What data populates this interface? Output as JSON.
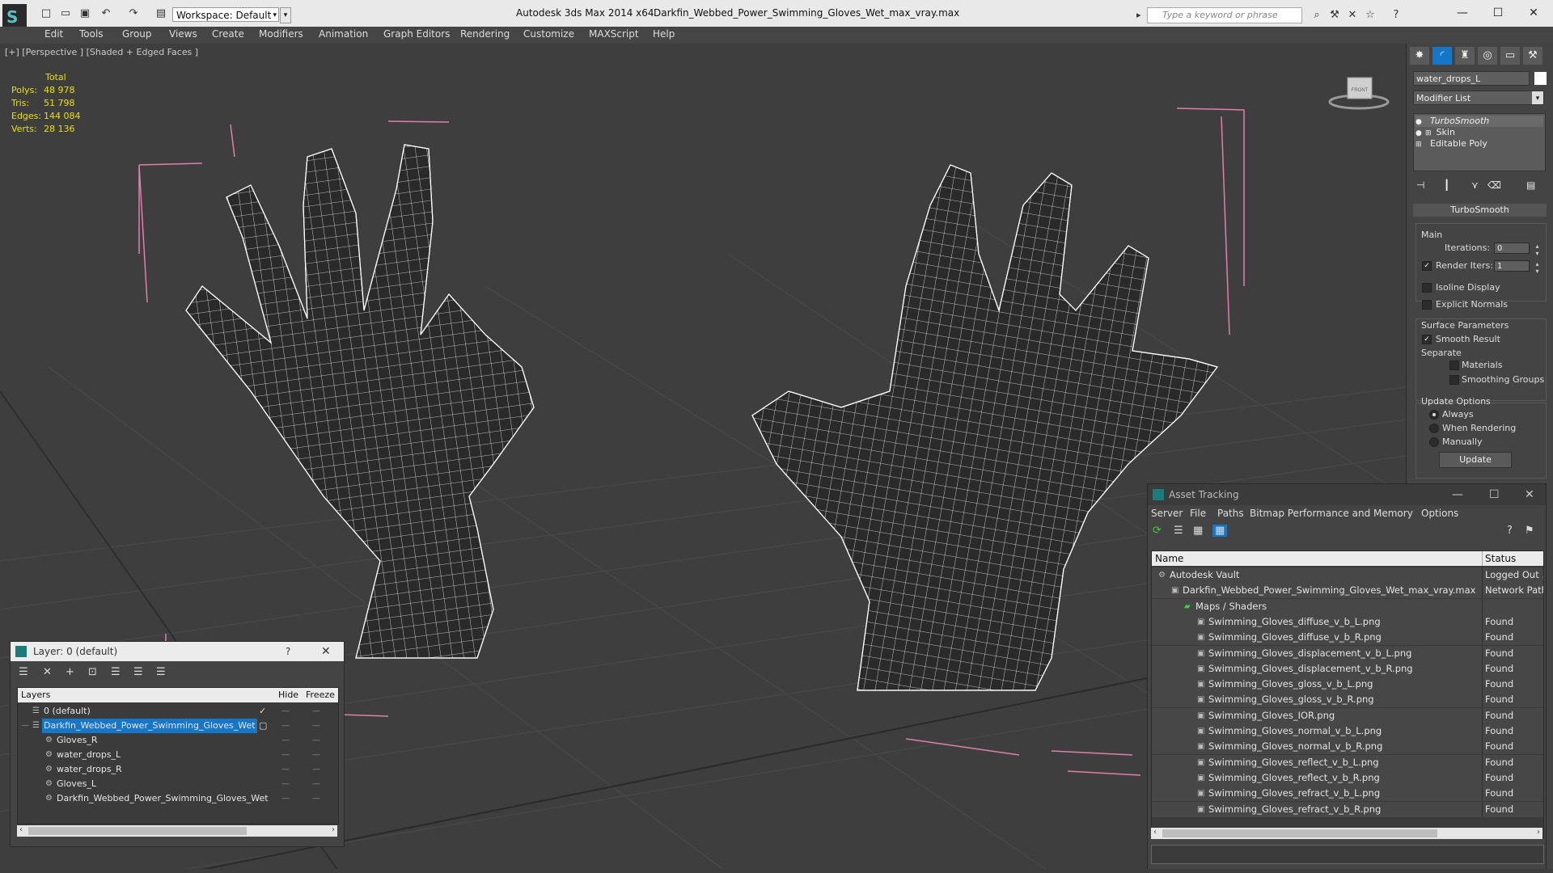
{
  "titlebar": {
    "workspace_label": "Workspace: Default",
    "app_title": "Autodesk 3ds Max  2014 x64",
    "file_title": "Darkfin_Webbed_Power_Swimming_Gloves_Wet_max_vray.max",
    "search_placeholder": "Type a keyword or phrase"
  },
  "menu": [
    "Edit",
    "Tools",
    "Group",
    "Views",
    "Create",
    "Modifiers",
    "Animation",
    "Graph Editors",
    "Rendering",
    "Customize",
    "MAXScript",
    "Help"
  ],
  "viewport": {
    "label": "[+] [Perspective ] [Shaded + Edged Faces ]",
    "stats": {
      "header": "Total",
      "rows": [
        {
          "k": "Polys:",
          "v": "48 978"
        },
        {
          "k": "Tris:",
          "v": "51 798"
        },
        {
          "k": "Edges:",
          "v": "144 084"
        },
        {
          "k": "Verts:",
          "v": "28 136"
        }
      ]
    },
    "viewcube_label": "FRONT"
  },
  "command_panel": {
    "object_name": "water_drops_L",
    "modifier_list": "Modifier List",
    "stack": [
      "TurboSmooth",
      "Skin",
      "Editable Poly"
    ],
    "rollout_title": "TurboSmooth",
    "main_label": "Main",
    "iterations_label": "Iterations:",
    "iterations_value": "0",
    "render_iters_label": "Render Iters:",
    "render_iters_value": "1",
    "isoline_label": "Isoline Display",
    "explicit_normals_label": "Explicit Normals",
    "surface_params_label": "Surface Parameters",
    "smooth_result_label": "Smooth Result",
    "separate_label": "Separate",
    "materials_label": "Materials",
    "smoothing_groups_label": "Smoothing Groups",
    "update_options_label": "Update Options",
    "always_label": "Always",
    "when_rendering_label": "When Rendering",
    "manually_label": "Manually",
    "update_button": "Update"
  },
  "layer_dialog": {
    "title": "Layer: 0 (default)",
    "help": "?",
    "col_layers": "Layers",
    "col_hide": "Hide",
    "col_freeze": "Freeze",
    "rows": [
      "0 (default)",
      "Darkfin_Webbed_Power_Swimming_Gloves_Wet",
      "Gloves_R",
      "water_drops_L",
      "water_drops_R",
      "Gloves_L",
      "Darkfin_Webbed_Power_Swimming_Gloves_Wet"
    ]
  },
  "asset_dialog": {
    "title": "Asset Tracking",
    "menu": [
      "Server",
      "File",
      "Paths",
      "Bitmap Performance and Memory",
      "Options"
    ],
    "col_name": "Name",
    "col_status": "Status",
    "rows": [
      {
        "name": "Autodesk Vault",
        "status": "Logged Out ..."
      },
      {
        "name": "Darkfin_Webbed_Power_Swimming_Gloves_Wet_max_vray.max",
        "status": "Network Path"
      },
      {
        "name": "Maps / Shaders",
        "status": ""
      },
      {
        "name": "Swimming_Gloves_diffuse_v_b_L.png",
        "status": "Found"
      },
      {
        "name": "Swimming_Gloves_diffuse_v_b_R.png",
        "status": "Found"
      },
      {
        "name": "Swimming_Gloves_displacement_v_b_L.png",
        "status": "Found"
      },
      {
        "name": "Swimming_Gloves_displacement_v_b_R.png",
        "status": "Found"
      },
      {
        "name": "Swimming_Gloves_gloss_v_b_L.png",
        "status": "Found"
      },
      {
        "name": "Swimming_Gloves_gloss_v_b_R.png",
        "status": "Found"
      },
      {
        "name": "Swimming_Gloves_IOR.png",
        "status": "Found"
      },
      {
        "name": "Swimming_Gloves_normal_v_b_L.png",
        "status": "Found"
      },
      {
        "name": "Swimming_Gloves_normal_v_b_R.png",
        "status": "Found"
      },
      {
        "name": "Swimming_Gloves_reflect_v_b_L.png",
        "status": "Found"
      },
      {
        "name": "Swimming_Gloves_reflect_v_b_R.png",
        "status": "Found"
      },
      {
        "name": "Swimming_Gloves_refract_v_b_L.png",
        "status": "Found"
      },
      {
        "name": "Swimming_Gloves_refract_v_b_R.png",
        "status": "Found"
      }
    ]
  },
  "colors": {
    "stats_yellow": "#e8e000",
    "selection_blue": "#1677c8",
    "bbox_pink": "#e07fa8",
    "wire_white": "#ffffff"
  }
}
